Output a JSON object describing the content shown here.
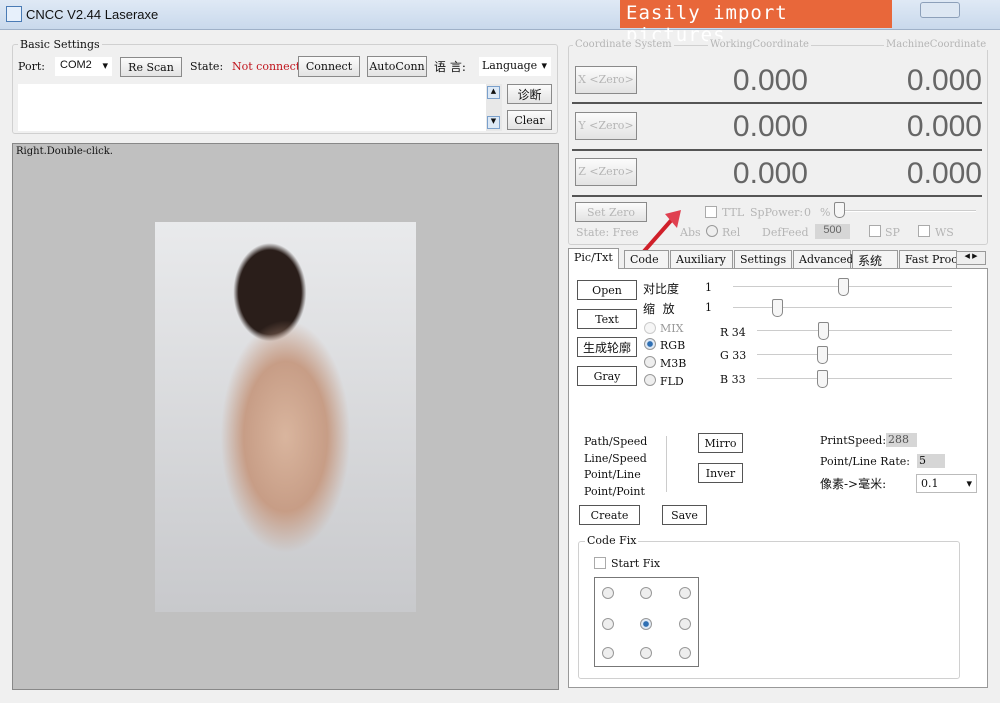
{
  "window": {
    "title": "CNCC V2.44  Laseraxe",
    "banner": "Easily import pictures"
  },
  "basic": {
    "group_label": "Basic Settings",
    "port_label": "Port:",
    "port_value": "COM2",
    "rescan": "Re Scan",
    "state_label": "State:",
    "state_value": "Not connect",
    "connect": "Connect",
    "autoconn": "AutoConn",
    "lang_label": "语 言:",
    "lang_value": "Language",
    "diag": "诊断",
    "clear": "Clear"
  },
  "canvas": {
    "hint": "Right.Double-click."
  },
  "coords": {
    "group_label": "Coordinate System",
    "working_label": "WorkingCoordinate",
    "machine_label": "MachineCoordinate",
    "rows": [
      {
        "btn": "X <Zero>",
        "work": "0.000",
        "mach": "0.000"
      },
      {
        "btn": "Y <Zero>",
        "work": "0.000",
        "mach": "0.000"
      },
      {
        "btn": "Z <Zero>",
        "work": "0.000",
        "mach": "0.000"
      }
    ],
    "set_zero": "Set Zero",
    "ttl": "TTL",
    "sppower_label": "SpPower:",
    "sppower_value": "0",
    "sppower_unit": "%",
    "state": "State: Free",
    "abs": "Abs",
    "rel": "Rel",
    "deffeed_label": "DefFeed",
    "deffeed_value": "500",
    "sp": "SP",
    "ws": "WS"
  },
  "tabs": [
    "Pic/Txt",
    "Code",
    "Auxiliary",
    "Settings",
    "Advanced",
    "系统",
    "Fast Proc"
  ],
  "pic": {
    "open": "Open",
    "text": "Text",
    "contour": "生成轮廓",
    "gray": "Gray",
    "contrast_label": "对比度",
    "contrast_value": "1",
    "contrast_level": 0.5,
    "scale_label": "缩  放",
    "scale_value": "1",
    "scale_level": 0.2,
    "modes": [
      "MIX",
      "RGB",
      "M3B",
      "FLD"
    ],
    "selected_mode": "RGB",
    "r_label": "R",
    "r_value": "34",
    "g_label": "G",
    "g_value": "33",
    "b_label": "B",
    "b_value": "33",
    "stats": [
      "Path/Speed",
      "Line/Speed",
      "Point/Line",
      "Point/Point"
    ],
    "mirror": "Mirro",
    "invert": "Inver",
    "print_speed_label": "PrintSpeed:",
    "print_speed": "288",
    "rate_label": "Point/Line Rate:",
    "rate": "5",
    "px_mm_label": "像素->毫米:",
    "px_mm": "0.1",
    "create": "Create",
    "save": "Save",
    "codefix_label": "Code Fix",
    "start_fix": "Start Fix"
  }
}
